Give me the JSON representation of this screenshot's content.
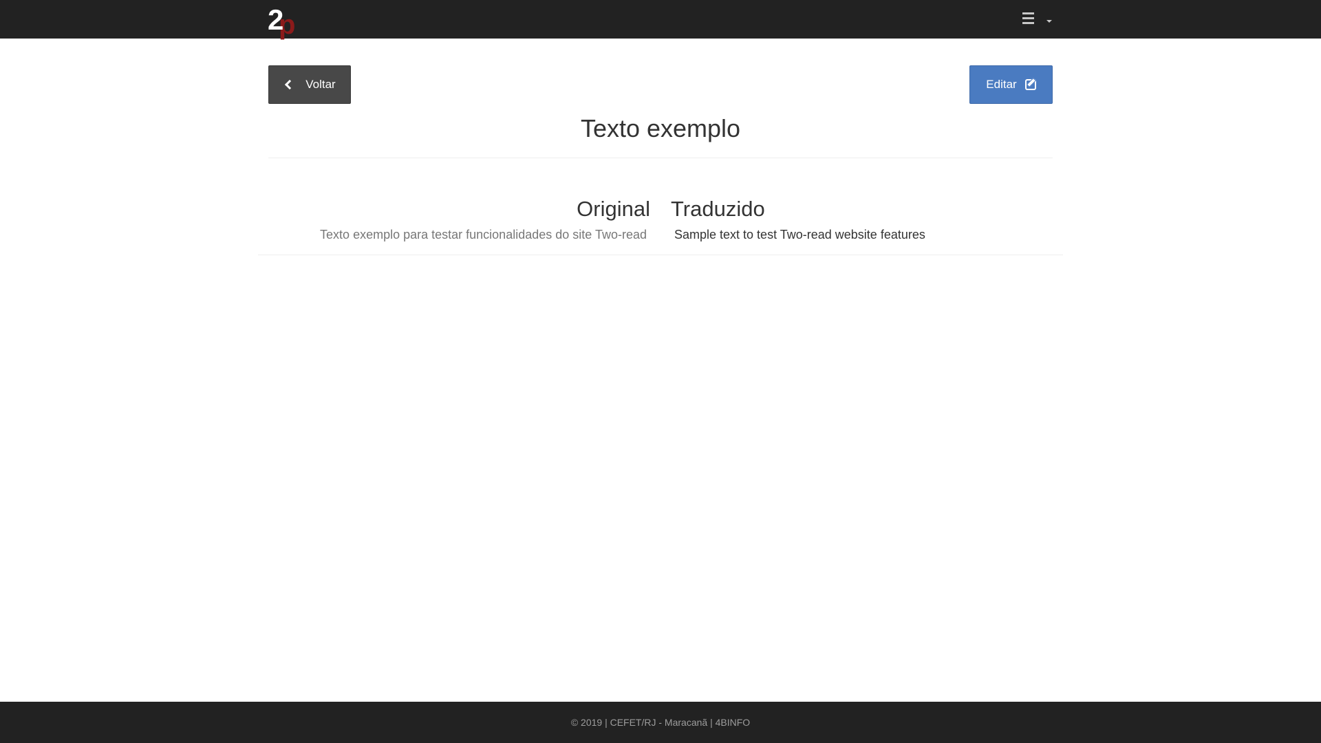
{
  "navbar": {
    "logo_main": "2",
    "logo_accent": "p",
    "menu_icon": "bars-icon",
    "menu_caret": "caret-down-icon"
  },
  "actions": {
    "back_label": "Voltar",
    "back_icon": "chevron-left-icon",
    "edit_label": "Editar",
    "edit_icon": "edit-icon"
  },
  "page": {
    "title": "Texto exemplo"
  },
  "columns": {
    "original_heading": "Original",
    "translated_heading": "Traduzido",
    "original_text": "Texto exemplo para testar funcionalidades do site Two-read",
    "translated_text": "Sample text to test Two-read website features"
  },
  "footer": {
    "text": "© 2019 | CEFET/RJ - Maracanã | 4BINFO"
  },
  "colors": {
    "navbar_bg": "#222222",
    "back_button": "#484848",
    "edit_button": "#4a7bc1",
    "logo_accent": "#8b1a1a"
  }
}
